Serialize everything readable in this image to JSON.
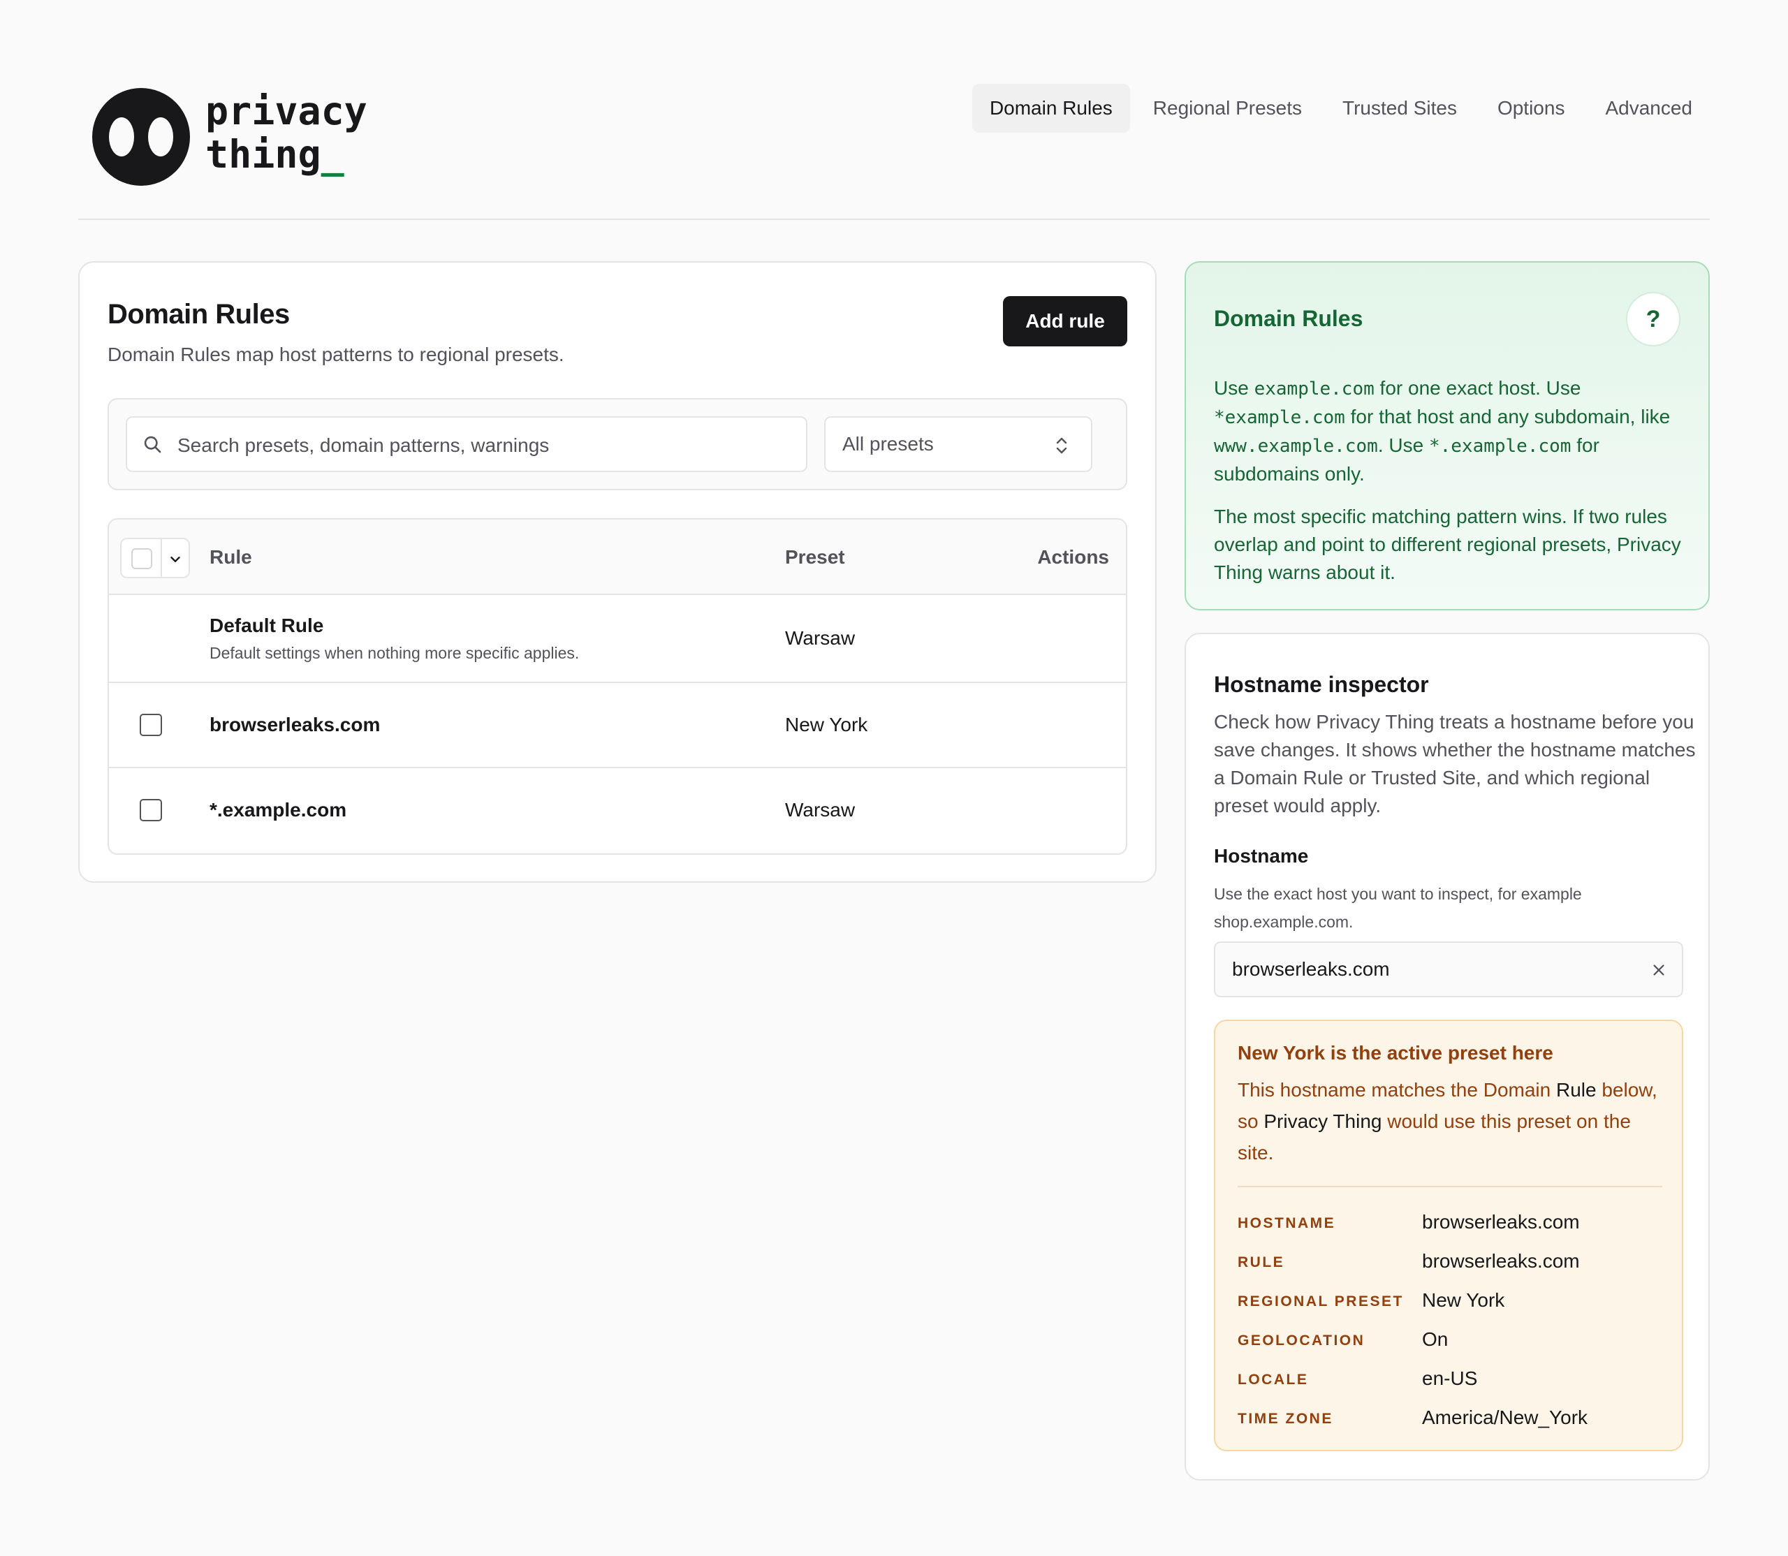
{
  "brand": {
    "line1": "privacy",
    "line2": "thing",
    "cursor": "_"
  },
  "nav": [
    {
      "label": "Domain Rules",
      "active": true
    },
    {
      "label": "Regional Presets",
      "active": false
    },
    {
      "label": "Trusted Sites",
      "active": false
    },
    {
      "label": "Options",
      "active": false
    },
    {
      "label": "Advanced",
      "active": false
    }
  ],
  "rules_panel": {
    "title": "Domain Rules",
    "subtitle": "Domain Rules map host patterns to regional presets.",
    "add_label": "Add rule",
    "search_placeholder": "Search presets, domain patterns, warnings",
    "preset_filter": "All presets",
    "columns": {
      "rule": "Rule",
      "preset": "Preset",
      "actions": "Actions"
    },
    "rows": [
      {
        "name": "Default Rule",
        "desc": "Default settings when nothing more specific applies.",
        "preset": "Warsaw"
      },
      {
        "name": "browserleaks.com",
        "preset": "New York"
      },
      {
        "name": "*.example.com",
        "preset": "Warsaw"
      }
    ]
  },
  "help": {
    "title": "Domain Rules",
    "q": "?",
    "p1": {
      "a": "Use ",
      "c1": "example.com",
      "b": " for one exact host. Use ",
      "c2": "*example.com",
      "d": " for that host and any subdomain, like ",
      "c3": "www.example.com",
      "e": ". Use ",
      "c4": "*.example.com",
      "f": " for subdomains only."
    },
    "p2": "The most specific matching pattern wins. If two rules overlap and point to different regional presets, Privacy Thing warns about it."
  },
  "inspector": {
    "title": "Hostname inspector",
    "desc": "Check how Privacy Thing treats a hostname before you save changes. It shows whether the hostname matches a Domain Rule or Trusted Site, and which regional preset would apply.",
    "label": "Hostname",
    "help": "Use the exact host you want to inspect, for example shop.example.com.",
    "value": "browserleaks.com",
    "result": {
      "title": "New York is the active preset here",
      "t1": "This hostname matches the Domain ",
      "t2": "Rule",
      "t3": " below, so ",
      "t4": "Privacy Thing",
      "t5": " would use this preset on the site.",
      "fields": [
        {
          "k": "HOSTNAME",
          "v": "browserleaks.com"
        },
        {
          "k": "RULE",
          "v": "browserleaks.com"
        },
        {
          "k": "REGIONAL PRESET",
          "v": "New York"
        },
        {
          "k": "GEOLOCATION",
          "v": "On"
        },
        {
          "k": "LOCALE",
          "v": "en-US"
        },
        {
          "k": "TIME ZONE",
          "v": "America/New_York"
        }
      ]
    }
  },
  "colors": {
    "accent": "#15803d",
    "warn": "#92400e",
    "dark": "#18181b"
  }
}
